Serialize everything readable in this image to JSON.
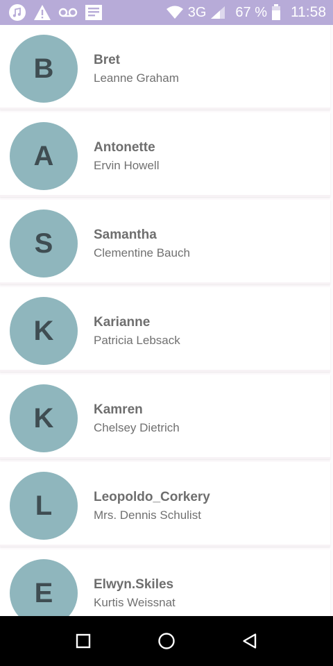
{
  "status_bar": {
    "battery_percent": "67 %",
    "network": "3G",
    "time": "11:58",
    "left_icons": [
      "music-icon",
      "warning-icon",
      "voicemail-icon",
      "news-icon"
    ],
    "right_icons": [
      "wifi-icon",
      "signal-icon",
      "battery-icon"
    ],
    "background_color": "#b7abd8"
  },
  "users": [
    {
      "initial": "B",
      "username": "Bret",
      "name": "Leanne Graham"
    },
    {
      "initial": "A",
      "username": "Antonette",
      "name": "Ervin Howell"
    },
    {
      "initial": "S",
      "username": "Samantha",
      "name": "Clementine Bauch"
    },
    {
      "initial": "K",
      "username": "Karianne",
      "name": "Patricia Lebsack"
    },
    {
      "initial": "K",
      "username": "Kamren",
      "name": "Chelsey Dietrich"
    },
    {
      "initial": "L",
      "username": "Leopoldo_Corkery",
      "name": "Mrs. Dennis Schulist"
    },
    {
      "initial": "E",
      "username": "Elwyn.Skiles",
      "name": "Kurtis Weissnat"
    }
  ],
  "theme": {
    "avatar_color": "#8fb6bd",
    "avatar_text_color": "#3f4d52"
  },
  "nav_bar": {
    "buttons": [
      "recents-square-icon",
      "home-circle-icon",
      "back-triangle-icon"
    ]
  }
}
